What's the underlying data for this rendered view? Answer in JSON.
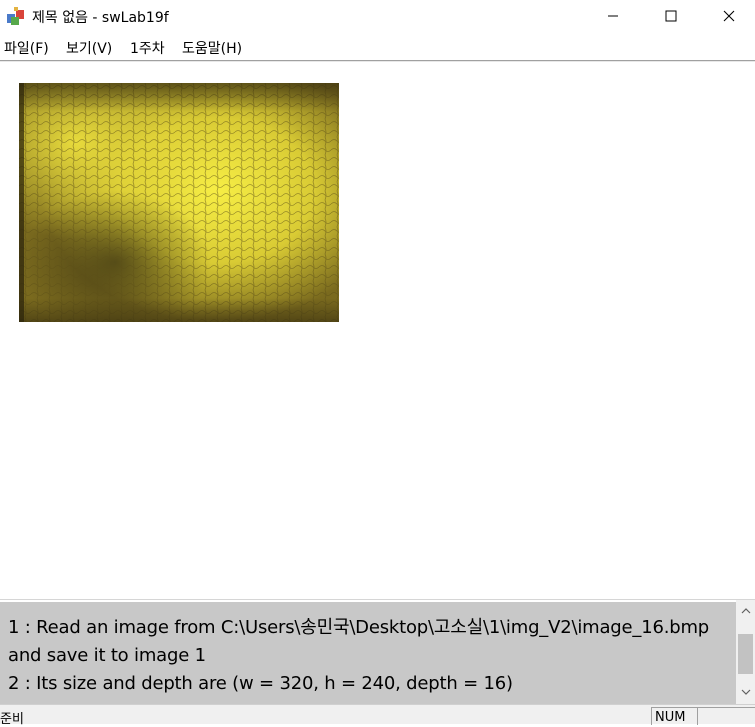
{
  "window": {
    "app_icon": "application-icon",
    "title": "제목 없음 - swLab19f",
    "buttons": [
      "minimize-icon",
      "maximize-icon",
      "close-icon"
    ]
  },
  "menubar": {
    "items": [
      {
        "label": "파일(F)"
      },
      {
        "label": "보기(V)"
      },
      {
        "label": "1주차"
      },
      {
        "label": "도움말(H)"
      }
    ]
  },
  "image_view": {
    "description_colors": {
      "dark": "#3a2f10",
      "mid": "#8f7f24",
      "bright": "#f2e63a"
    }
  },
  "log": {
    "lines": [
      "1 : Read an image from C:\\Users\\송민국\\Desktop\\고소실\\1\\img_V2\\image_16.bmp",
      "and save it to image 1",
      "2 :   Its size and depth are (w = 320, h = 240, depth = 16)"
    ]
  },
  "statusbar": {
    "status": "준비",
    "num": "NUM"
  },
  "colors": {
    "log_background": "#c8c8c8",
    "statusbar_background": "#f0f0f0"
  }
}
